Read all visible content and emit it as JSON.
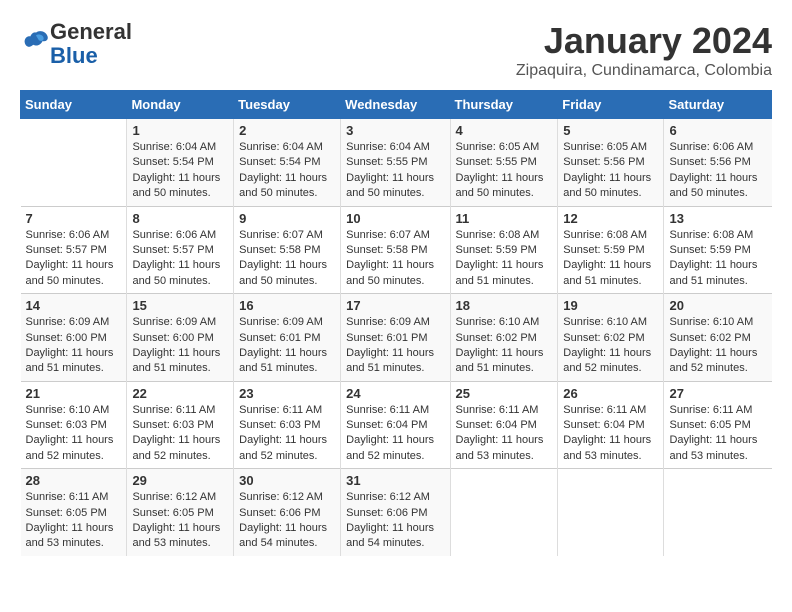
{
  "header": {
    "logo_general": "General",
    "logo_blue": "Blue",
    "month_title": "January 2024",
    "location": "Zipaquira, Cundinamarca, Colombia"
  },
  "days_of_week": [
    "Sunday",
    "Monday",
    "Tuesday",
    "Wednesday",
    "Thursday",
    "Friday",
    "Saturday"
  ],
  "weeks": [
    [
      {
        "day": "",
        "sunrise": "",
        "sunset": "",
        "daylight": ""
      },
      {
        "day": "1",
        "sunrise": "Sunrise: 6:04 AM",
        "sunset": "Sunset: 5:54 PM",
        "daylight": "Daylight: 11 hours and 50 minutes."
      },
      {
        "day": "2",
        "sunrise": "Sunrise: 6:04 AM",
        "sunset": "Sunset: 5:54 PM",
        "daylight": "Daylight: 11 hours and 50 minutes."
      },
      {
        "day": "3",
        "sunrise": "Sunrise: 6:04 AM",
        "sunset": "Sunset: 5:55 PM",
        "daylight": "Daylight: 11 hours and 50 minutes."
      },
      {
        "day": "4",
        "sunrise": "Sunrise: 6:05 AM",
        "sunset": "Sunset: 5:55 PM",
        "daylight": "Daylight: 11 hours and 50 minutes."
      },
      {
        "day": "5",
        "sunrise": "Sunrise: 6:05 AM",
        "sunset": "Sunset: 5:56 PM",
        "daylight": "Daylight: 11 hours and 50 minutes."
      },
      {
        "day": "6",
        "sunrise": "Sunrise: 6:06 AM",
        "sunset": "Sunset: 5:56 PM",
        "daylight": "Daylight: 11 hours and 50 minutes."
      }
    ],
    [
      {
        "day": "7",
        "sunrise": "Sunrise: 6:06 AM",
        "sunset": "Sunset: 5:57 PM",
        "daylight": "Daylight: 11 hours and 50 minutes."
      },
      {
        "day": "8",
        "sunrise": "Sunrise: 6:06 AM",
        "sunset": "Sunset: 5:57 PM",
        "daylight": "Daylight: 11 hours and 50 minutes."
      },
      {
        "day": "9",
        "sunrise": "Sunrise: 6:07 AM",
        "sunset": "Sunset: 5:58 PM",
        "daylight": "Daylight: 11 hours and 50 minutes."
      },
      {
        "day": "10",
        "sunrise": "Sunrise: 6:07 AM",
        "sunset": "Sunset: 5:58 PM",
        "daylight": "Daylight: 11 hours and 50 minutes."
      },
      {
        "day": "11",
        "sunrise": "Sunrise: 6:08 AM",
        "sunset": "Sunset: 5:59 PM",
        "daylight": "Daylight: 11 hours and 51 minutes."
      },
      {
        "day": "12",
        "sunrise": "Sunrise: 6:08 AM",
        "sunset": "Sunset: 5:59 PM",
        "daylight": "Daylight: 11 hours and 51 minutes."
      },
      {
        "day": "13",
        "sunrise": "Sunrise: 6:08 AM",
        "sunset": "Sunset: 5:59 PM",
        "daylight": "Daylight: 11 hours and 51 minutes."
      }
    ],
    [
      {
        "day": "14",
        "sunrise": "Sunrise: 6:09 AM",
        "sunset": "Sunset: 6:00 PM",
        "daylight": "Daylight: 11 hours and 51 minutes."
      },
      {
        "day": "15",
        "sunrise": "Sunrise: 6:09 AM",
        "sunset": "Sunset: 6:00 PM",
        "daylight": "Daylight: 11 hours and 51 minutes."
      },
      {
        "day": "16",
        "sunrise": "Sunrise: 6:09 AM",
        "sunset": "Sunset: 6:01 PM",
        "daylight": "Daylight: 11 hours and 51 minutes."
      },
      {
        "day": "17",
        "sunrise": "Sunrise: 6:09 AM",
        "sunset": "Sunset: 6:01 PM",
        "daylight": "Daylight: 11 hours and 51 minutes."
      },
      {
        "day": "18",
        "sunrise": "Sunrise: 6:10 AM",
        "sunset": "Sunset: 6:02 PM",
        "daylight": "Daylight: 11 hours and 51 minutes."
      },
      {
        "day": "19",
        "sunrise": "Sunrise: 6:10 AM",
        "sunset": "Sunset: 6:02 PM",
        "daylight": "Daylight: 11 hours and 52 minutes."
      },
      {
        "day": "20",
        "sunrise": "Sunrise: 6:10 AM",
        "sunset": "Sunset: 6:02 PM",
        "daylight": "Daylight: 11 hours and 52 minutes."
      }
    ],
    [
      {
        "day": "21",
        "sunrise": "Sunrise: 6:10 AM",
        "sunset": "Sunset: 6:03 PM",
        "daylight": "Daylight: 11 hours and 52 minutes."
      },
      {
        "day": "22",
        "sunrise": "Sunrise: 6:11 AM",
        "sunset": "Sunset: 6:03 PM",
        "daylight": "Daylight: 11 hours and 52 minutes."
      },
      {
        "day": "23",
        "sunrise": "Sunrise: 6:11 AM",
        "sunset": "Sunset: 6:03 PM",
        "daylight": "Daylight: 11 hours and 52 minutes."
      },
      {
        "day": "24",
        "sunrise": "Sunrise: 6:11 AM",
        "sunset": "Sunset: 6:04 PM",
        "daylight": "Daylight: 11 hours and 52 minutes."
      },
      {
        "day": "25",
        "sunrise": "Sunrise: 6:11 AM",
        "sunset": "Sunset: 6:04 PM",
        "daylight": "Daylight: 11 hours and 53 minutes."
      },
      {
        "day": "26",
        "sunrise": "Sunrise: 6:11 AM",
        "sunset": "Sunset: 6:04 PM",
        "daylight": "Daylight: 11 hours and 53 minutes."
      },
      {
        "day": "27",
        "sunrise": "Sunrise: 6:11 AM",
        "sunset": "Sunset: 6:05 PM",
        "daylight": "Daylight: 11 hours and 53 minutes."
      }
    ],
    [
      {
        "day": "28",
        "sunrise": "Sunrise: 6:11 AM",
        "sunset": "Sunset: 6:05 PM",
        "daylight": "Daylight: 11 hours and 53 minutes."
      },
      {
        "day": "29",
        "sunrise": "Sunrise: 6:12 AM",
        "sunset": "Sunset: 6:05 PM",
        "daylight": "Daylight: 11 hours and 53 minutes."
      },
      {
        "day": "30",
        "sunrise": "Sunrise: 6:12 AM",
        "sunset": "Sunset: 6:06 PM",
        "daylight": "Daylight: 11 hours and 54 minutes."
      },
      {
        "day": "31",
        "sunrise": "Sunrise: 6:12 AM",
        "sunset": "Sunset: 6:06 PM",
        "daylight": "Daylight: 11 hours and 54 minutes."
      },
      {
        "day": "",
        "sunrise": "",
        "sunset": "",
        "daylight": ""
      },
      {
        "day": "",
        "sunrise": "",
        "sunset": "",
        "daylight": ""
      },
      {
        "day": "",
        "sunrise": "",
        "sunset": "",
        "daylight": ""
      }
    ]
  ]
}
